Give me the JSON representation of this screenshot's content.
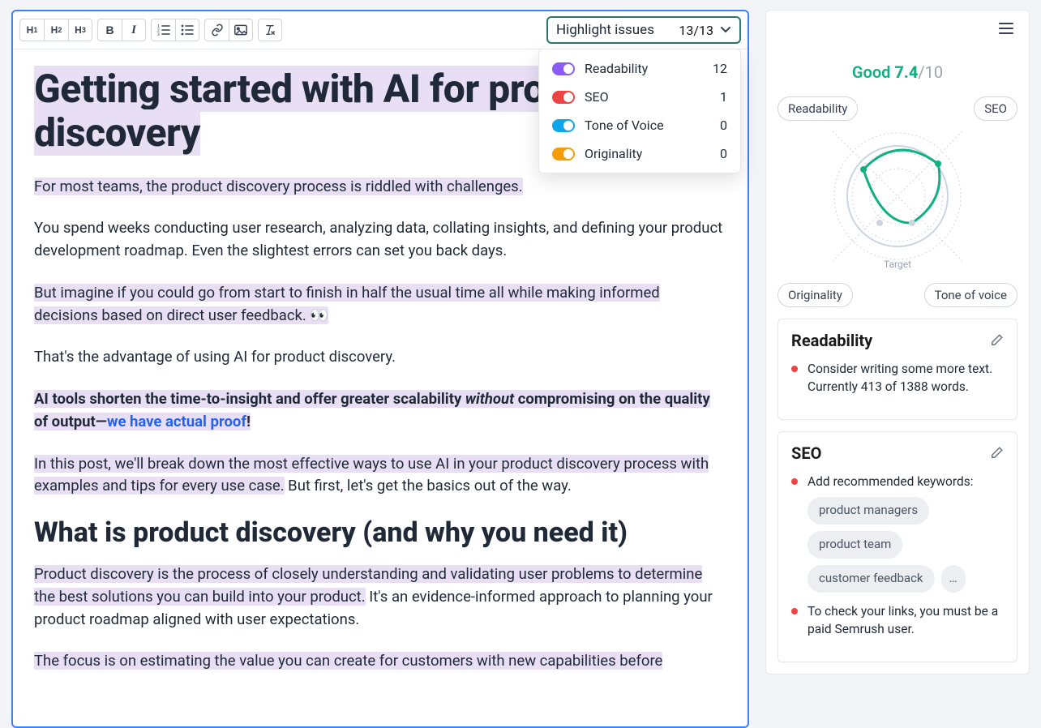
{
  "toolbar": {
    "highlight": {
      "label": "Highlight issues",
      "count": "13/13"
    }
  },
  "dropdown": [
    {
      "label": "Readability",
      "count": "12",
      "color": "purple"
    },
    {
      "label": "SEO",
      "count": "1",
      "color": "red"
    },
    {
      "label": "Tone of Voice",
      "count": "0",
      "color": "blue"
    },
    {
      "label": "Originality",
      "count": "0",
      "color": "yellow"
    }
  ],
  "doc": {
    "h1": "Getting started with AI for product discovery",
    "p1": "For most teams, the product discovery process is riddled with challenges.",
    "p2": "You spend weeks conducting user research, analyzing data, collating insights, and defining your product development roadmap. Even the slightest errors can set you back days.",
    "p3": "But imagine if you could go from start to finish in half the usual time all while making informed decisions based on direct user feedback. 👀",
    "p4": "That's the advantage of using AI for product discovery.",
    "p5a": "AI tools shorten the time-to-insight and offer greater scalability ",
    "p5b": "without",
    "p5c": " compromising on the quality of output—",
    "p5d": "we have actual proof",
    "p5e": "!",
    "p6a": "In this post, we'll break down the most effective ways to use AI in your product discovery process with examples and tips for every use case.",
    "p6b": " But first, let's get the basics out of the way.",
    "h2": "What is product discovery (and why you need it)",
    "p7a": "Product discovery is the process of closely understanding and validating user problems to determine the best solutions you can build into your product.",
    "p7b": " It's an evidence-informed approach to planning your product roadmap aligned with user expectations.",
    "p8": "The focus is on estimating the value you can create for customers with new capabilities before"
  },
  "score": {
    "label": "Good",
    "value": "7.4",
    "of": "/10",
    "pills": {
      "tl": "Readability",
      "tr": "SEO",
      "bl": "Originality",
      "br": "Tone of voice"
    },
    "target": "Target"
  },
  "cards": {
    "readability": {
      "title": "Readability",
      "item": "Consider writing some more text. Currently 413 of 1388 words."
    },
    "seo": {
      "title": "SEO",
      "item1": "Add recommended keywords:",
      "chips": [
        "product managers",
        "product team",
        "customer feedback"
      ],
      "more": "…",
      "item2": "To check your links, you must be a paid Semrush user."
    }
  }
}
